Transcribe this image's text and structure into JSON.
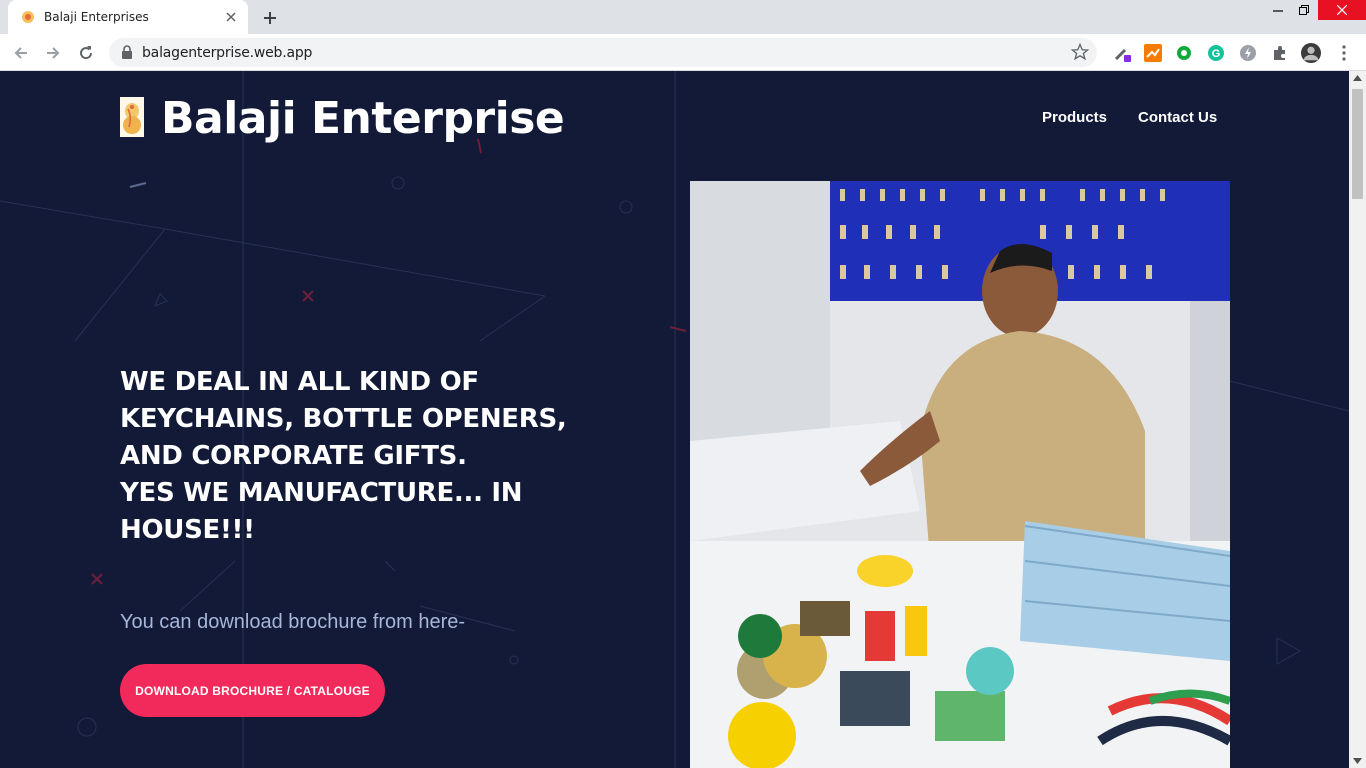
{
  "browser": {
    "tab_title": "Balaji Enterprises",
    "url": "balagenterprise.web.app"
  },
  "header": {
    "brand": "Balaji Enterprise",
    "nav": [
      {
        "label": "Products"
      },
      {
        "label": "Contact Us"
      }
    ]
  },
  "hero": {
    "headline_lines": [
      "WE DEAL IN ALL KIND OF",
      "KEYCHAINS, BOTTLE OPENERS,",
      "AND CORPORATE GIFTS.",
      "YES WE MANUFACTURE... IN",
      "HOUSE!!!"
    ],
    "subtext": "You can download brochure from here-",
    "cta_label": "DOWNLOAD BROCHURE / CATALOUGE"
  },
  "colors": {
    "page_bg": "#121a37",
    "accent": "#f2295b",
    "subtext": "#a7b6d9"
  }
}
